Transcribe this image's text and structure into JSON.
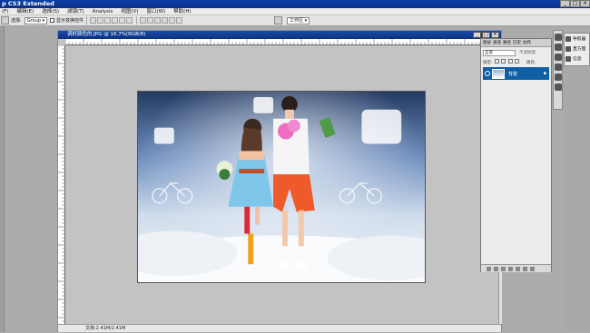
{
  "window": {
    "title": "p CS3 Extended",
    "min": "_",
    "max": "□",
    "close": "×"
  },
  "menu": [
    "(F)",
    "编辑(E)",
    "选择(S)",
    "滤镜(T)",
    "Analysis",
    "视图(V)",
    "窗口(W)",
    "帮助(H)"
  ],
  "options": {
    "label": "选择:",
    "group_value": "Group",
    "show_transform": "显示变换控件",
    "workspace": "工作区 ▾"
  },
  "document": {
    "title": "调好颜色的.JPG @ 16.7%(RGB/8)",
    "status": "文档:2.41M/2.41M"
  },
  "layers_panel": {
    "tabs": [
      "图层",
      "通道",
      "路径",
      "历史",
      "动作"
    ],
    "blend_mode": "正常",
    "opacity": "不透明度:",
    "lock": "锁定:",
    "fill": "填充:",
    "layer_name": "背景"
  },
  "nav_panel": {
    "items": [
      "导航器",
      "直方图",
      "信息"
    ]
  },
  "colors": {
    "titlebar": "#0a3fa8",
    "layer_selected": "#0f5ea6",
    "workspace": "#ababab"
  }
}
